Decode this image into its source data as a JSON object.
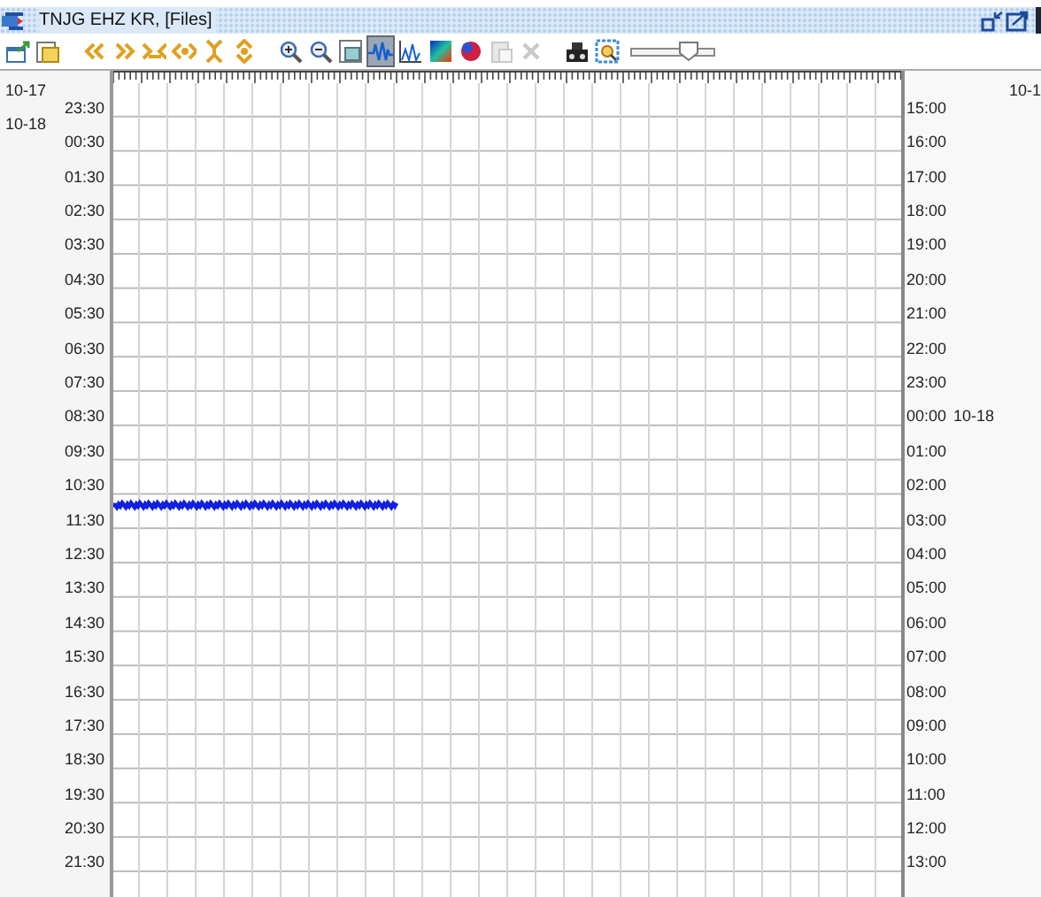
{
  "window": {
    "title": "TNJG EHZ KR, [Files]"
  },
  "toolbar": {
    "groups": [
      [
        {
          "kind": "export",
          "selected": false,
          "disabled": false
        },
        {
          "kind": "window",
          "selected": false,
          "disabled": false
        }
      ],
      [
        {
          "kind": "rewind",
          "selected": false,
          "disabled": false
        },
        {
          "kind": "forward",
          "selected": false,
          "disabled": false
        },
        {
          "kind": "compress-h",
          "selected": false,
          "disabled": false
        },
        {
          "kind": "expand-h",
          "selected": false,
          "disabled": false
        },
        {
          "kind": "compress-v",
          "selected": false,
          "disabled": false
        },
        {
          "kind": "expand-v",
          "selected": false,
          "disabled": false
        }
      ],
      [
        {
          "kind": "zoom-in",
          "selected": false,
          "disabled": false
        },
        {
          "kind": "zoom-out",
          "selected": false,
          "disabled": false
        },
        {
          "kind": "frame",
          "selected": false,
          "disabled": false
        },
        {
          "kind": "waveform",
          "selected": true,
          "disabled": false
        },
        {
          "kind": "spectrum",
          "selected": false,
          "disabled": false
        },
        {
          "kind": "spectrogram",
          "selected": false,
          "disabled": false
        },
        {
          "kind": "color-ball",
          "selected": false,
          "disabled": false
        },
        {
          "kind": "paste",
          "selected": false,
          "disabled": true
        },
        {
          "kind": "delete",
          "selected": false,
          "disabled": true
        }
      ],
      [
        {
          "kind": "device",
          "selected": false,
          "disabled": false
        },
        {
          "kind": "scan",
          "selected": false,
          "disabled": false
        }
      ]
    ],
    "slider": {
      "level": 0.7
    }
  },
  "chart": {
    "right_header": "10-1",
    "rows": [
      {
        "left_day": "10-17",
        "left_time": "23:30",
        "right_time": "15:00"
      },
      {
        "left_day": "10-18",
        "left_time": "00:30",
        "right_time": "16:00"
      },
      {
        "left_time": "01:30",
        "right_time": "17:00"
      },
      {
        "left_time": "02:30",
        "right_time": "18:00"
      },
      {
        "left_time": "03:30",
        "right_time": "19:00"
      },
      {
        "left_time": "04:30",
        "right_time": "20:00"
      },
      {
        "left_time": "05:30",
        "right_time": "21:00"
      },
      {
        "left_time": "06:30",
        "right_time": "22:00"
      },
      {
        "left_time": "07:30",
        "right_time": "23:00"
      },
      {
        "left_time": "08:30",
        "right_time": "00:00",
        "right_day": "10-18"
      },
      {
        "left_time": "09:30",
        "right_time": "01:00"
      },
      {
        "left_time": "10:30",
        "right_time": "02:00"
      },
      {
        "left_time": "11:30",
        "right_time": "03:00"
      },
      {
        "left_time": "12:30",
        "right_time": "04:00"
      },
      {
        "left_time": "13:30",
        "right_time": "05:00"
      },
      {
        "left_time": "14:30",
        "right_time": "06:00"
      },
      {
        "left_time": "15:30",
        "right_time": "07:00"
      },
      {
        "left_time": "16:30",
        "right_time": "08:00"
      },
      {
        "left_time": "17:30",
        "right_time": "09:00"
      },
      {
        "left_time": "18:30",
        "right_time": "10:00"
      },
      {
        "left_time": "19:30",
        "right_time": "11:00"
      },
      {
        "left_time": "20:30",
        "right_time": "12:00"
      },
      {
        "left_time": "21:30",
        "right_time": "13:00"
      }
    ]
  }
}
